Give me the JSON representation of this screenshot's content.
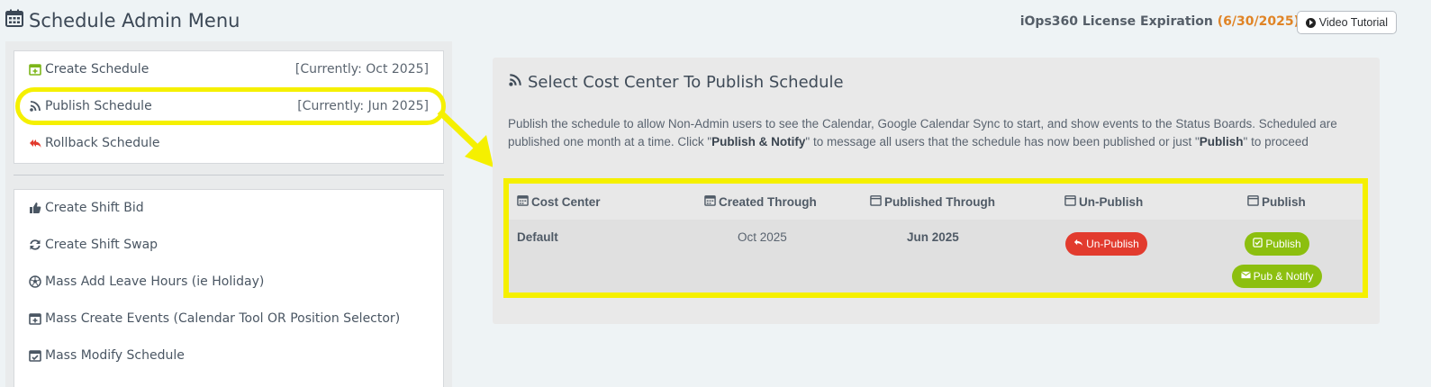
{
  "header": {
    "title": "Schedule Admin Menu",
    "license_label": "iOps360 License Expiration",
    "license_date": "(6/30/2025)",
    "video_button": "Video Tutorial"
  },
  "sidebar": {
    "group1": [
      {
        "label": "Create Schedule",
        "current": "[Currently: Oct 2025]"
      },
      {
        "label": "Publish Schedule",
        "current": "[Currently: Jun 2025]"
      },
      {
        "label": "Rollback Schedule",
        "current": ""
      }
    ],
    "group2": [
      {
        "label": "Create Shift Bid"
      },
      {
        "label": "Create Shift Swap"
      },
      {
        "label": "Mass Add Leave Hours (ie Holiday)"
      },
      {
        "label": "Mass Create Events (Calendar Tool OR Position Selector)"
      },
      {
        "label": "Mass Modify Schedule"
      }
    ]
  },
  "main": {
    "title": "Select Cost Center To Publish Schedule",
    "desc_part1": "Publish the schedule to allow Non-Admin users to see the Calendar, Google Calendar Sync to start, and show events to the Status Boards. Scheduled are published one month at a time. Click \"",
    "desc_bold1": "Publish & Notify",
    "desc_part2": "\" to message all users that the schedule has now been published or just \"",
    "desc_bold2": "Publish",
    "desc_part3": "\" to proceed",
    "table": {
      "headers": [
        "Cost Center",
        "Created Through",
        "Published Through",
        "Un-Publish",
        "Publish"
      ],
      "rows": [
        {
          "cost_center": "Default",
          "created": "Oct 2025",
          "published": "Jun 2025"
        }
      ],
      "unpublish_label": "Un-Publish",
      "publish_label": "Publish",
      "pub_notify_label": "Pub & Notify"
    }
  },
  "colors": {
    "highlight": "#f5f000",
    "danger": "#e23b2e",
    "success": "#8cbf0f",
    "license_date": "#e08426"
  }
}
